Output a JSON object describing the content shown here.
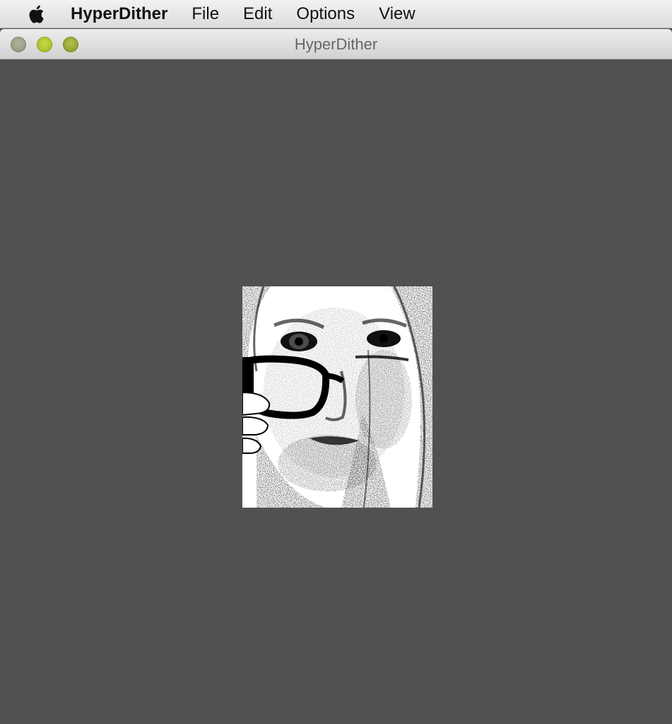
{
  "menubar": {
    "apple_icon": "apple-logo-icon",
    "app_name": "HyperDither",
    "items": [
      "File",
      "Edit",
      "Options",
      "View"
    ]
  },
  "window": {
    "title": "HyperDither",
    "controls": [
      "close",
      "minimize",
      "zoom"
    ]
  },
  "canvas": {
    "background": "#525053",
    "image": {
      "description": "dithered-portrait-image",
      "palette": [
        "#000000",
        "#ffffff"
      ]
    }
  }
}
